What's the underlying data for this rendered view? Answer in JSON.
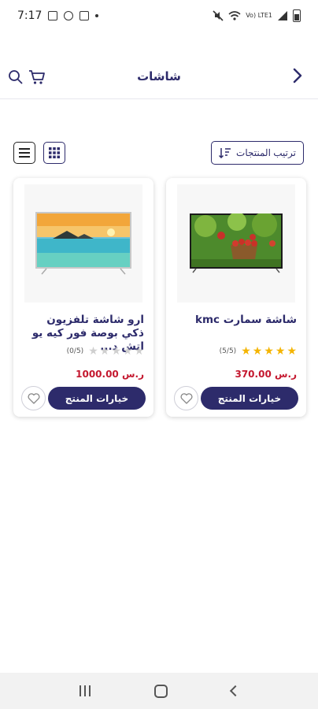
{
  "status_bar": {
    "time": "7:17",
    "network": "Vo) LTE1"
  },
  "header": {
    "title": "شاشات"
  },
  "toolbar": {
    "sort_label": "ترتيب المنتجات"
  },
  "products": [
    {
      "title": "شاشة سمارت kmc",
      "rating_text": "(5/5)",
      "rating": 5,
      "price": "370.00 ر.س",
      "options_label": "خيارات المنتج"
    },
    {
      "title": "ارو شاشة تلفزيون ذكي بوصة فور كيه يو اتش د...",
      "rating_text": "(0/5)",
      "rating": 0,
      "price": "1000.00 ر.س",
      "options_label": "خيارات المنتج"
    }
  ],
  "colors": {
    "primary": "#2d2b6b",
    "price": "#c4182f",
    "star": "#f4b400"
  }
}
